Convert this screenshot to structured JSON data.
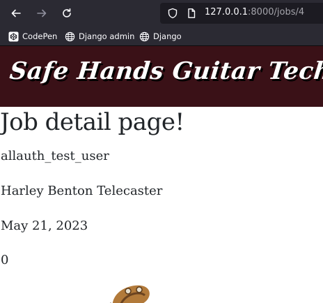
{
  "browser": {
    "url_host": "127.0.0.1",
    "url_rest": ":8000/jobs/4",
    "bookmarks": [
      "CodePen",
      "Django admin",
      "Django"
    ]
  },
  "header": {
    "brand": "Safe Hands Guitar Tech"
  },
  "job": {
    "page_title": "Job detail page!",
    "user": "allauth_test_user",
    "instrument": "Harley Benton Telecaster",
    "date": "May 21, 2023",
    "value": "0"
  },
  "icons": {
    "back": "arrow-left-icon",
    "forward": "arrow-right-icon",
    "reload": "reload-icon",
    "shield": "shield-icon",
    "page": "page-icon",
    "codepen": "codepen-icon",
    "globe": "globe-icon",
    "guitar": "guitar-image"
  },
  "colors": {
    "chrome": "#2b2a33",
    "header_bg": "#3a1117",
    "text": "#212529"
  }
}
